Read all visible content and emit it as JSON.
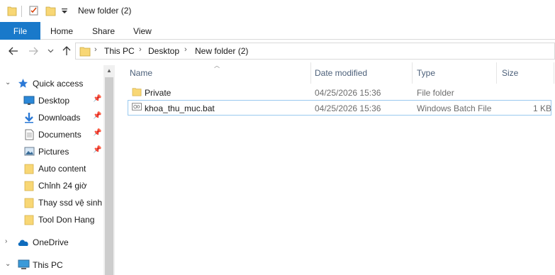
{
  "window": {
    "title": "New folder (2)"
  },
  "ribbon": {
    "tabs": [
      "File",
      "Home",
      "Share",
      "View"
    ]
  },
  "breadcrumb": [
    "This PC",
    "Desktop",
    "New folder (2)"
  ],
  "sidebar": {
    "items": [
      {
        "label": "Quick access",
        "icon": "star-icon",
        "pinned": false
      },
      {
        "label": "Desktop",
        "icon": "desktop-icon",
        "pinned": true
      },
      {
        "label": "Downloads",
        "icon": "download-icon",
        "pinned": true
      },
      {
        "label": "Documents",
        "icon": "documents-icon",
        "pinned": true
      },
      {
        "label": "Pictures",
        "icon": "pictures-icon",
        "pinned": true
      },
      {
        "label": "Auto content",
        "icon": "folder-icon",
        "pinned": false
      },
      {
        "label": "Chỉnh 24 giờ",
        "icon": "folder-icon",
        "pinned": false
      },
      {
        "label": "Thay ssd vệ sinh l",
        "icon": "folder-icon",
        "pinned": false
      },
      {
        "label": "Tool Don Hang",
        "icon": "folder-icon",
        "pinned": false
      },
      {
        "label": "OneDrive",
        "icon": "cloud-icon",
        "pinned": false
      },
      {
        "label": "This PC",
        "icon": "computer-icon",
        "pinned": false
      }
    ]
  },
  "columns": {
    "name": "Name",
    "date": "Date modified",
    "type": "Type",
    "size": "Size"
  },
  "files": [
    {
      "name": "Private",
      "date": "04/25/2026 15:36",
      "type": "File folder",
      "size": "",
      "icon": "folder-icon"
    },
    {
      "name": "khoa_thu_muc.bat",
      "date": "04/25/2026 15:36",
      "type": "Windows Batch File",
      "size": "1 KB",
      "icon": "batch-file-icon"
    }
  ],
  "colors": {
    "accent": "#1979ca",
    "folder": "#f8d775",
    "selection_border": "#99c9ef"
  }
}
